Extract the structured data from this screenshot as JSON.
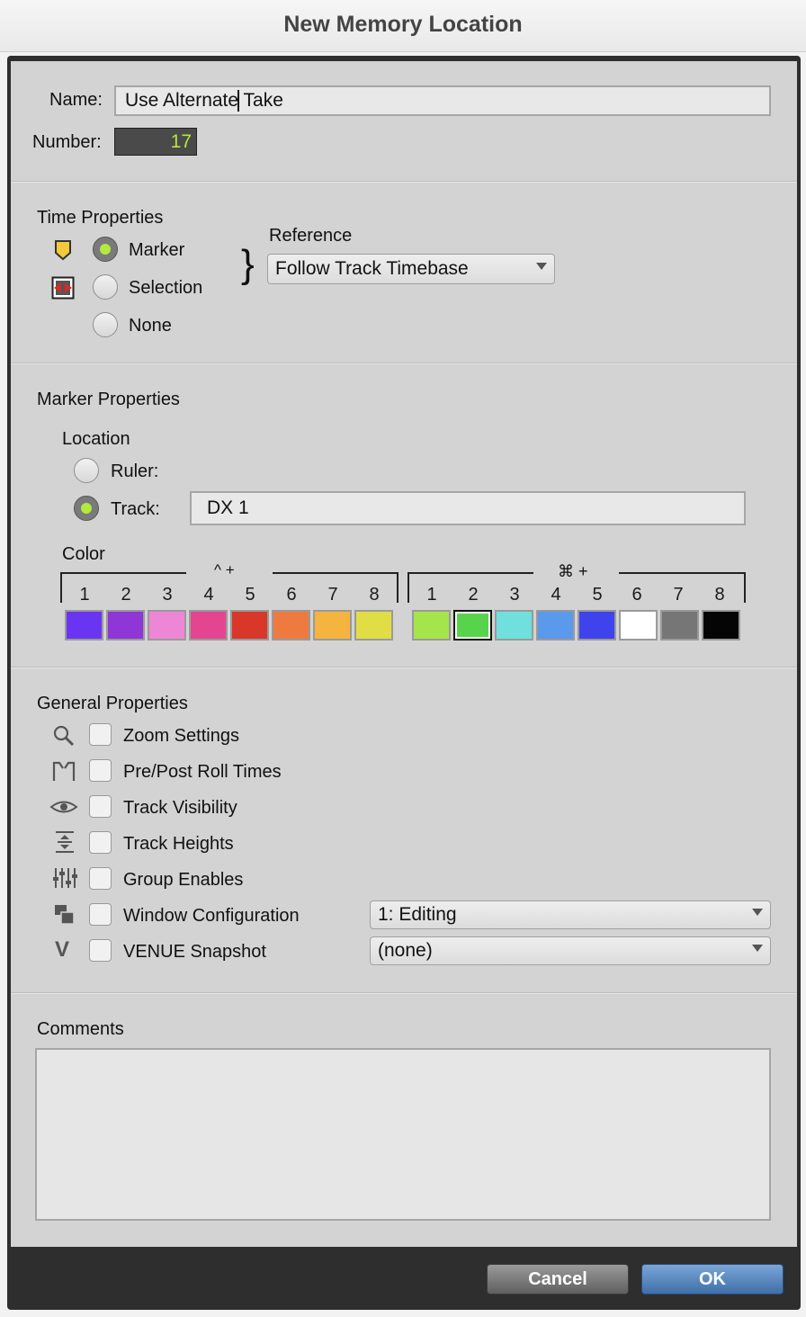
{
  "window": {
    "title": "New Memory Location"
  },
  "header": {
    "name_label": "Name:",
    "name_value_before_cursor": "Use Alternate",
    "name_value_after_cursor": " Take",
    "number_label": "Number:",
    "number_value": "17"
  },
  "time_properties": {
    "title": "Time Properties",
    "options": [
      "Marker",
      "Selection",
      "None"
    ],
    "selected": "Marker",
    "reference_label": "Reference",
    "reference_value": "Follow Track Timebase"
  },
  "marker_properties": {
    "title": "Marker Properties",
    "location_label": "Location",
    "ruler_label": "Ruler:",
    "track_label": "Track:",
    "track_value": "DX 1",
    "location_selected": "Track",
    "color_label": "Color",
    "group1_modifier": "^ +",
    "group2_modifier": "⌘ +",
    "numbers": [
      "1",
      "2",
      "3",
      "4",
      "5",
      "6",
      "7",
      "8"
    ],
    "group1_colors": [
      "#6a35f0",
      "#8f36d6",
      "#ee86d6",
      "#e44591",
      "#d8372a",
      "#ef7a40",
      "#f5b43f",
      "#e1de45"
    ],
    "group2_colors": [
      "#a4e54b",
      "#58d44c",
      "#6fe0dd",
      "#5a99ec",
      "#3f43eb",
      "#ffffff",
      "#767676",
      "#050505"
    ],
    "selected_color": "group2-2"
  },
  "general_properties": {
    "title": "General Properties",
    "items": [
      {
        "label": "Zoom Settings",
        "icon": "magnifier-icon",
        "checked": false
      },
      {
        "label": "Pre/Post Roll Times",
        "icon": "preroll-icon",
        "checked": false
      },
      {
        "label": "Track Visibility",
        "icon": "eye-icon",
        "checked": false
      },
      {
        "label": "Track Heights",
        "icon": "track-height-icon",
        "checked": false
      },
      {
        "label": "Group Enables",
        "icon": "faders-icon",
        "checked": false
      },
      {
        "label": "Window Configuration",
        "icon": "windows-icon",
        "checked": false
      },
      {
        "label": "VENUE Snapshot",
        "icon": "venue-icon",
        "checked": false
      }
    ],
    "window_config_value": "1: Editing",
    "venue_value": "(none)"
  },
  "comments": {
    "title": "Comments",
    "value": ""
  },
  "buttons": {
    "cancel": "Cancel",
    "ok": "OK"
  }
}
